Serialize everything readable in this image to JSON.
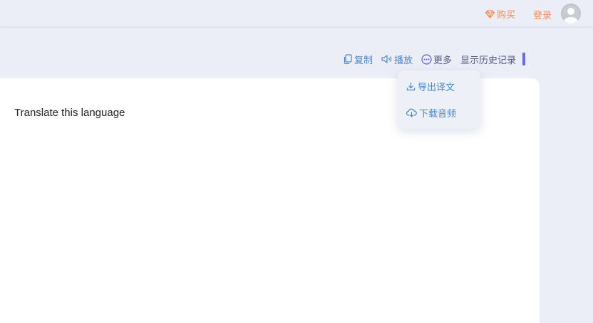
{
  "header": {
    "buy_label": "购买",
    "login_label": "登录",
    "accent_color": "#f28b54"
  },
  "toolbar": {
    "copy_label": "复制",
    "play_label": "播放",
    "more_label": "更多",
    "history_label": "显示历史记录"
  },
  "dropdown": {
    "items": [
      {
        "label": "导出译文",
        "icon": "download-icon"
      },
      {
        "label": "下载音频",
        "icon": "cloud-download-icon"
      }
    ]
  },
  "editor": {
    "source_text": "Translate this language"
  },
  "colors": {
    "link_blue": "#4b86c8",
    "history_bar": "#6b6bdc",
    "background": "#eceef7"
  }
}
